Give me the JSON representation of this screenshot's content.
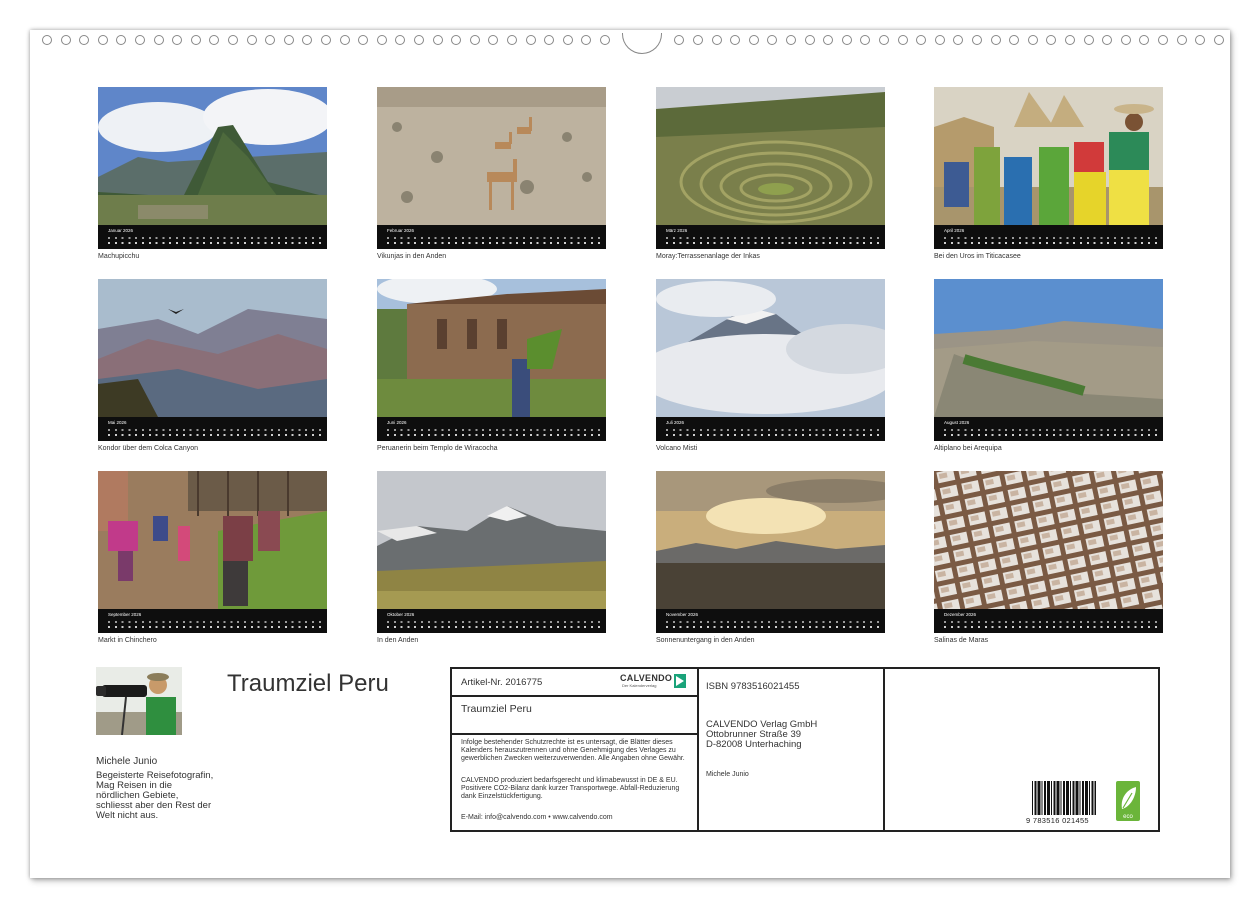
{
  "months": [
    {
      "label": "Januar 2026",
      "caption": "Machupicchu"
    },
    {
      "label": "Februar 2026",
      "caption": "Vikunjas in den Anden"
    },
    {
      "label": "März 2026",
      "caption": "Moray:Terrassenanlage der Inkas"
    },
    {
      "label": "April 2026",
      "caption": "Bei den Uros im Titicacasee"
    },
    {
      "label": "Mai 2026",
      "caption": "Kondor über dem Colca Canyon"
    },
    {
      "label": "Juni 2026",
      "caption": "Peruanerin beim Templo de Wiracocha"
    },
    {
      "label": "Juli 2026",
      "caption": "Volcano Misti"
    },
    {
      "label": "August 2026",
      "caption": "Altiplano bei Arequipa"
    },
    {
      "label": "September 2026",
      "caption": "Markt in Chinchero"
    },
    {
      "label": "Oktober 2026",
      "caption": "In den Anden"
    },
    {
      "label": "November 2026",
      "caption": "Sonnenuntergang in den Anden"
    },
    {
      "label": "Dezember 2026",
      "caption": "Salinas de Maras"
    }
  ],
  "author": {
    "name": "Michele Junio",
    "bio": "Begeisterte Reisefotografin, Mag Reisen in die nördlichen Gebiete, schliesst aber den Rest der Welt nicht aus."
  },
  "title": "Traumziel Peru",
  "info": {
    "article": "Artikel-Nr. 2016775",
    "logo": "CALVENDO",
    "logo_sub": "Der Kalenderverlag",
    "title": "Traumziel Peru",
    "legal1": "Infolge bestehender Schutzrechte ist es untersagt, die Blätter dieses Kalenders herauszutrennen und ohne Genehmigung des Verlages zu gewerblichen Zwecken weiterzuverwenden. Alle Angaben ohne Gewähr.",
    "legal2": "CALVENDO produziert bedarfsgerecht und klimabewusst in DE & EU. Positivere CO2-Bilanz dank kurzer Transportwege. Abfall-Reduzierung dank Einzelstückfertigung.",
    "contact": "E-Mail: info@calvendo.com • www.calvendo.com",
    "isbn": "ISBN 9783516021455",
    "publisher1": "CALVENDO Verlag GmbH",
    "publisher2": "Ottobrunner Straße 39",
    "publisher3": "D-82008 Unterhaching",
    "author": "Michele Junio",
    "barcode_number": "9 783516 021455",
    "eco_label": "eco"
  }
}
